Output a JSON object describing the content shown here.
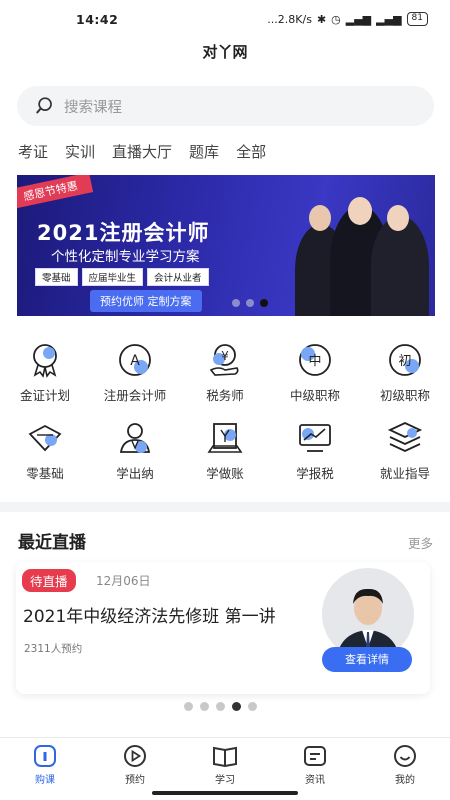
{
  "status": {
    "time": "14:42",
    "net": "...2.8K/s",
    "battery": "81"
  },
  "app": {
    "title": "对丫网"
  },
  "search": {
    "placeholder": "搜索课程"
  },
  "categories": [
    "考证",
    "实训",
    "直播大厅",
    "题库",
    "全部"
  ],
  "banner": {
    "ribbon": "感恩节特惠",
    "title": "2021注册会计师",
    "subtitle": "个性化定制专业学习方案",
    "tags": [
      "零基础",
      "应届毕业生",
      "会计从业者"
    ],
    "cta": "预约优师 定制方案"
  },
  "grid": [
    {
      "label": "金证计划",
      "icon": "medal-icon"
    },
    {
      "label": "注册会计师",
      "icon": "letter-a-icon"
    },
    {
      "label": "税务师",
      "icon": "yen-hand-icon"
    },
    {
      "label": "中级职称",
      "icon": "zhong-icon"
    },
    {
      "label": "初级职称",
      "icon": "chu-icon"
    },
    {
      "label": "零基础",
      "icon": "diamond-icon"
    },
    {
      "label": "学出纳",
      "icon": "cashier-icon"
    },
    {
      "label": "学做账",
      "icon": "ledger-icon"
    },
    {
      "label": "学报税",
      "icon": "tax-chart-icon"
    },
    {
      "label": "就业指导",
      "icon": "layers-icon"
    }
  ],
  "live": {
    "heading": "最近直播",
    "more": "更多",
    "card": {
      "badge": "待直播",
      "date": "12月06日",
      "title": "2021年中级经济法先修班 第一讲",
      "count": "2311人预约",
      "button": "查看详情"
    },
    "pager_active": 3
  },
  "tabs": [
    {
      "label": "购课",
      "active": true
    },
    {
      "label": "预约",
      "active": false
    },
    {
      "label": "学习",
      "active": false
    },
    {
      "label": "资讯",
      "active": false
    },
    {
      "label": "我的",
      "active": false
    }
  ],
  "colors": {
    "accent": "#2f66e8",
    "badge": "#e63c4d",
    "banner_bg": "#2c2aa8"
  }
}
